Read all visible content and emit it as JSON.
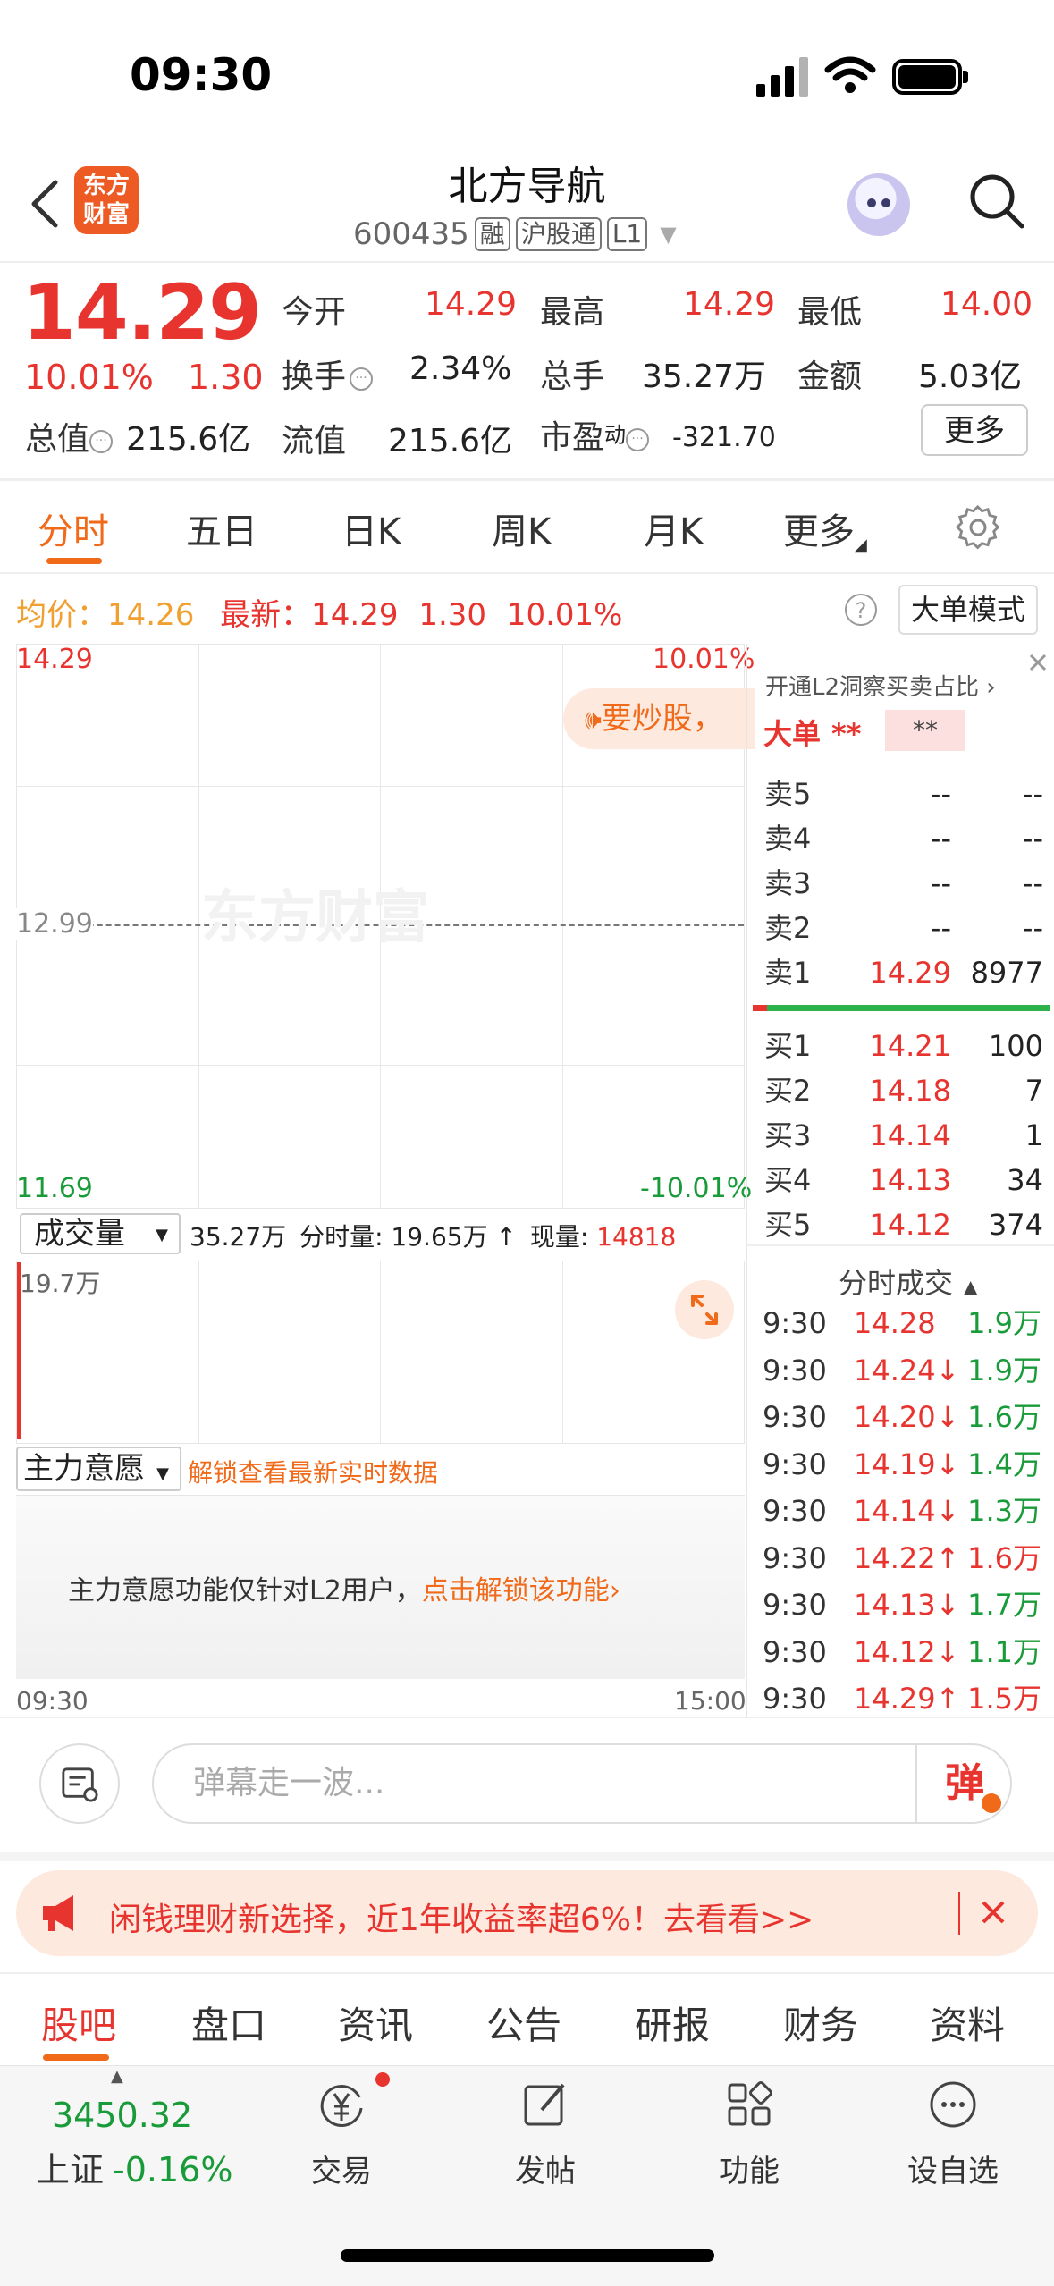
{
  "status": {
    "time": "09:30"
  },
  "header": {
    "logo_line1": "东方",
    "logo_line2": "财富",
    "title": "北方导航",
    "code": "600435",
    "tags": [
      "融",
      "沪股通",
      "L1"
    ]
  },
  "quote": {
    "price": "14.29",
    "pct": "10.01%",
    "change": "1.30",
    "total_value_label": "总值",
    "total_value": "215.6亿",
    "fields": [
      {
        "label": "今开",
        "value": "14.29"
      },
      {
        "label": "最高",
        "value": "14.29"
      },
      {
        "label": "最低",
        "value": "14.00"
      },
      {
        "label": "换手",
        "value": "2.34%"
      },
      {
        "label": "总手",
        "value": "35.27万"
      },
      {
        "label": "金额",
        "value": "5.03亿"
      },
      {
        "label": "流值",
        "value": "215.6亿"
      },
      {
        "label": "市盈",
        "label_sup": "动",
        "value": "-321.70"
      }
    ],
    "more": "更多"
  },
  "tabs": [
    "分时",
    "五日",
    "日K",
    "周K",
    "月K",
    "更多"
  ],
  "avg_bar": {
    "avg_label": "均价：",
    "avg": "14.26",
    "latest_label": "最新：",
    "latest": "14.29",
    "latest_change": "1.30",
    "latest_pct": "10.01%",
    "mode": "大单模式",
    "help": "?"
  },
  "chart": {
    "y_top": "14.29",
    "y_mid": "12.99",
    "y_bottom": "11.69",
    "pct_top": "10.01%",
    "pct_bottom": "-10.01%",
    "watermark": "东方财富",
    "promo_pill": "要炒股，",
    "time_start": "09:30",
    "time_end": "15:00"
  },
  "volume": {
    "selector": "成交量",
    "total": "35.27万",
    "interval_label": "分时量:",
    "interval": "19.65万",
    "arrow": "↑",
    "current_label": "现量:",
    "current": "14818",
    "max": "19.7万"
  },
  "main_force": {
    "selector": "主力意愿",
    "unlock_hint": "解锁查看最新实时数据",
    "notice": "主力意愿功能仅针对L2用户，",
    "notice_link": "点击解锁该功能"
  },
  "order_book": {
    "l2_banner": "开通L2洞察买卖占比",
    "big_order_label": "大单",
    "big_order_stars": "**",
    "big_order_box": "**",
    "asks": [
      {
        "label": "卖5",
        "price": "--",
        "vol": "--"
      },
      {
        "label": "卖4",
        "price": "--",
        "vol": "--"
      },
      {
        "label": "卖3",
        "price": "--",
        "vol": "--"
      },
      {
        "label": "卖2",
        "price": "--",
        "vol": "--"
      },
      {
        "label": "卖1",
        "price": "14.29",
        "vol": "8977"
      }
    ],
    "bids": [
      {
        "label": "买1",
        "price": "14.21",
        "vol": "100"
      },
      {
        "label": "买2",
        "price": "14.18",
        "vol": "7"
      },
      {
        "label": "买3",
        "price": "14.14",
        "vol": "1"
      },
      {
        "label": "买4",
        "price": "14.13",
        "vol": "34"
      },
      {
        "label": "买5",
        "price": "14.12",
        "vol": "374"
      }
    ]
  },
  "trades": {
    "title": "分时成交",
    "rows": [
      {
        "time": "9:30",
        "price": "14.28",
        "dir": "",
        "vol": "1.9万",
        "color": "green"
      },
      {
        "time": "9:30",
        "price": "14.24↓",
        "dir": "down",
        "vol": "1.9万",
        "color": "green"
      },
      {
        "time": "9:30",
        "price": "14.20↓",
        "dir": "down",
        "vol": "1.6万",
        "color": "green"
      },
      {
        "time": "9:30",
        "price": "14.19↓",
        "dir": "down",
        "vol": "1.4万",
        "color": "green"
      },
      {
        "time": "9:30",
        "price": "14.14↓",
        "dir": "down",
        "vol": "1.3万",
        "color": "green"
      },
      {
        "time": "9:30",
        "price": "14.22↑",
        "dir": "up",
        "vol": "1.6万",
        "color": "red"
      },
      {
        "time": "9:30",
        "price": "14.13↓",
        "dir": "down",
        "vol": "1.7万",
        "color": "green"
      },
      {
        "time": "9:30",
        "price": "14.12↓",
        "dir": "down",
        "vol": "1.1万",
        "color": "green"
      },
      {
        "time": "9:30",
        "price": "14.29↑",
        "dir": "up",
        "vol": "1.5万",
        "color": "red"
      }
    ]
  },
  "comment": {
    "placeholder": "弹幕走一波...",
    "danmu": "弹"
  },
  "promo": {
    "text": "闲钱理财新选择，近1年收益率超6%！去看看>>"
  },
  "bottom_tabs": [
    "股吧",
    "盘口",
    "资讯",
    "公告",
    "研报",
    "财务",
    "资料"
  ],
  "tabbar": {
    "index_value": "3450.32",
    "index_name": "上证",
    "index_pct": "-0.16%",
    "items": [
      "交易",
      "发帖",
      "功能",
      "设自选"
    ]
  }
}
